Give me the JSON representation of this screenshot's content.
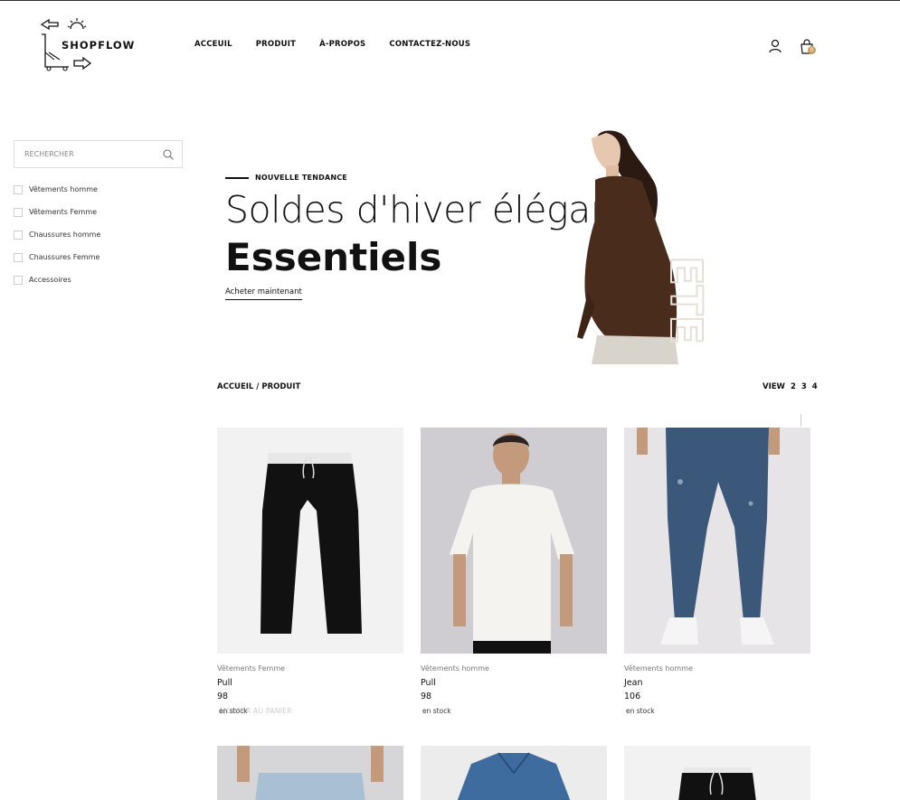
{
  "header": {
    "logo_text": "SHOPFLOW",
    "nav": [
      "ACCEUIL",
      "PRODUIT",
      "À-PROPOS",
      "CONTACTEZ-NOUS"
    ],
    "cart_count": "0"
  },
  "sidebar": {
    "search_placeholder": "RECHERCHER",
    "categories": [
      "Vêtements homme",
      "Vêtements Femme",
      "Chaussures homme",
      "Chaussures Femme",
      "Accessoires"
    ]
  },
  "hero": {
    "tag": "NOUVELLE TENDANCE",
    "title": "Soldes d'hiver élégants",
    "subtitle": "Essentiels",
    "cta": "Acheter maintenant",
    "image_text": "ETE"
  },
  "toolbar": {
    "breadcrumb": "ACCUEIL / PRODUIT",
    "view_label": "VIEW",
    "view_options": [
      "2",
      "3",
      "4"
    ]
  },
  "products": [
    {
      "category": "Vêtements Femme",
      "name": "Pull",
      "price": "98",
      "stock": "en stock",
      "overlay": "AJOUTER AU PANIER"
    },
    {
      "category": "Vêtements homme",
      "name": "Pull",
      "price": "98",
      "stock": "en stock"
    },
    {
      "category": "Vêtements homme",
      "name": "Jean",
      "price": "106",
      "stock": "en stock"
    }
  ],
  "colors": {
    "accent": "#c8a064",
    "text": "#111111"
  }
}
